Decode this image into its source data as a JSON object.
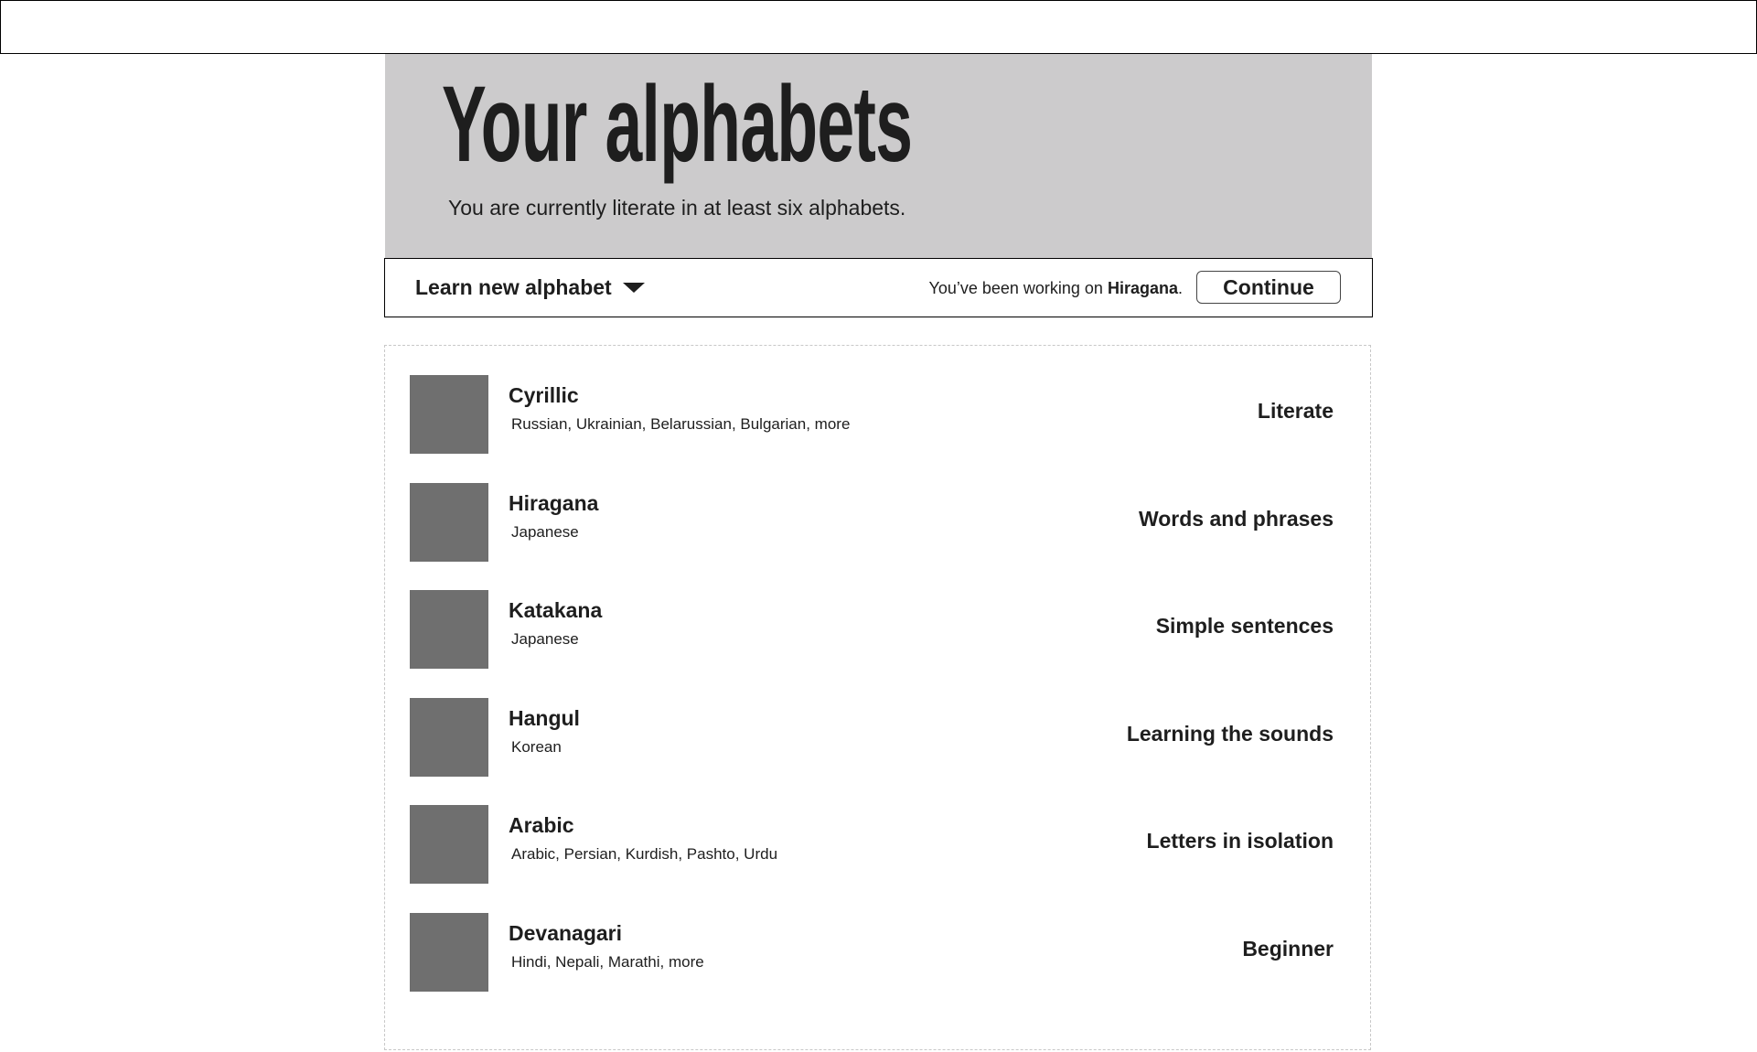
{
  "header": {
    "title": "Your alphabets",
    "subtitle": "You are currently literate in at least six alphabets."
  },
  "toolbar": {
    "learn_label": "Learn new alphabet",
    "working_prefix": "You’ve been working on ",
    "working_alphabet": "Hiragana",
    "working_suffix": ".",
    "continue_label": "Continue"
  },
  "alphabets": [
    {
      "name": "Cyrillic",
      "languages": "Russian, Ukrainian, Belarussian, Bulgarian, more",
      "status": "Literate"
    },
    {
      "name": "Hiragana",
      "languages": "Japanese",
      "status": "Words and phrases"
    },
    {
      "name": "Katakana",
      "languages": "Japanese",
      "status": "Simple sentences"
    },
    {
      "name": "Hangul",
      "languages": "Korean",
      "status": "Learning the sounds"
    },
    {
      "name": "Arabic",
      "languages": "Arabic, Persian, Kurdish, Pashto, Urdu",
      "status": "Letters in isolation"
    },
    {
      "name": "Devanagari",
      "languages": "Hindi, Nepali, Marathi, more",
      "status": "Beginner"
    }
  ]
}
